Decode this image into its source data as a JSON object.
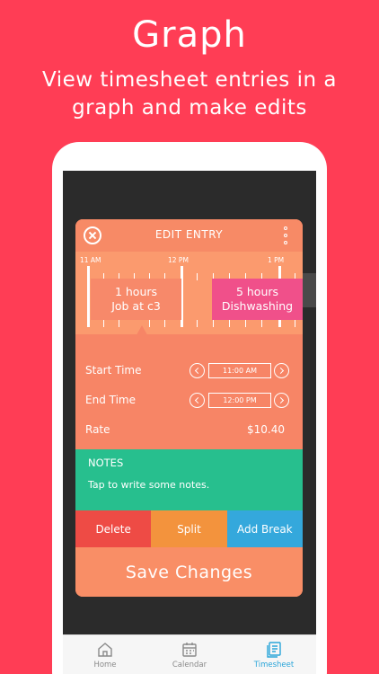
{
  "promo": {
    "headline": "Graph",
    "subline": "View timesheet entries in a graph and make edits"
  },
  "edit_entry": {
    "title": "EDIT ENTRY",
    "close_icon": "close-circle-icon",
    "menu_icon": "kebab-menu-icon",
    "timeline": {
      "labels": [
        "11 AM",
        "12 PM",
        "1 PM"
      ],
      "entries": [
        {
          "hours": "1 hours",
          "name": "Job at c3",
          "color": "#f7896a"
        },
        {
          "hours": "5 hours",
          "name": "Dishwashing",
          "color": "#f0508a"
        }
      ]
    },
    "start_time": {
      "label": "Start Time",
      "value": "11:00 AM"
    },
    "end_time": {
      "label": "End Time",
      "value": "12:00 PM"
    },
    "rate": {
      "label": "Rate",
      "value": "$10.40"
    },
    "notes": {
      "heading": "NOTES",
      "placeholder": "Tap to write some notes."
    },
    "actions": {
      "delete": "Delete",
      "split": "Split",
      "add_break": "Add Break"
    },
    "save_label": "Save Changes"
  },
  "tabbar": {
    "tabs": [
      {
        "label": "Home",
        "icon": "home-icon",
        "active": false
      },
      {
        "label": "Calendar",
        "icon": "calendar-icon",
        "active": false
      },
      {
        "label": "Timesheet",
        "icon": "timesheet-icon",
        "active": true
      }
    ]
  },
  "colors": {
    "background": "#ff3d55",
    "card": "#f78566",
    "notes": "#27bf8e",
    "delete": "#ee4b45",
    "split": "#f3933d",
    "add_break": "#34a8dc",
    "active_tab": "#2aa5d9"
  }
}
